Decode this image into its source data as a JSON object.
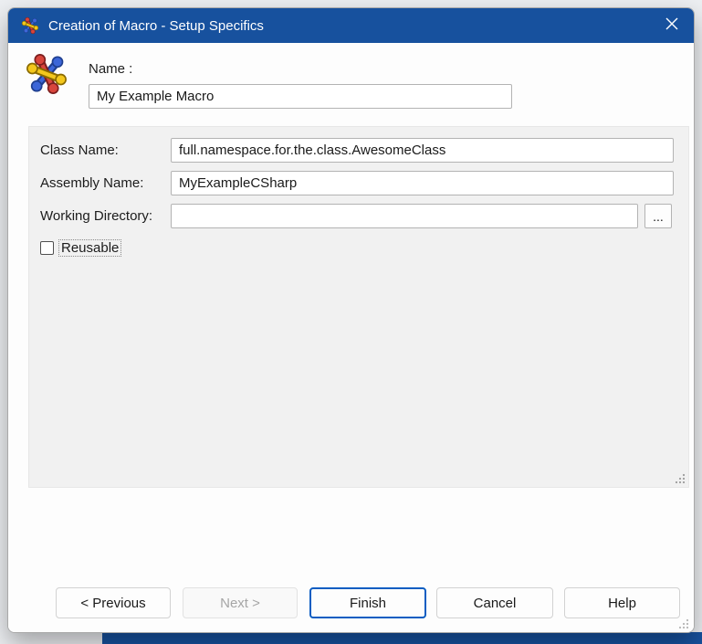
{
  "colors": {
    "titlebar": "#17519E",
    "accent": "#0A5DC2",
    "panel": "#F1F1F1"
  },
  "window": {
    "title": "Creation of Macro - Setup Specifics"
  },
  "header": {
    "name_label": "Name :",
    "name_value": "My Example Macro"
  },
  "form": {
    "class_name_label": "Class Name:",
    "class_name_value": "full.namespace.for.the.class.AwesomeClass",
    "assembly_name_label": "Assembly Name:",
    "assembly_name_value": "MyExampleCSharp",
    "working_directory_label": "Working Directory:",
    "working_directory_value": "",
    "browse_label": "...",
    "reusable_label": "Reusable",
    "reusable_checked": false
  },
  "buttons": {
    "previous": "< Previous",
    "next": "Next >",
    "finish": "Finish",
    "cancel": "Cancel",
    "help": "Help"
  },
  "icons": {
    "titlebar_icon": "macro-icon",
    "close": "close-icon",
    "resize": "resize-grip"
  }
}
